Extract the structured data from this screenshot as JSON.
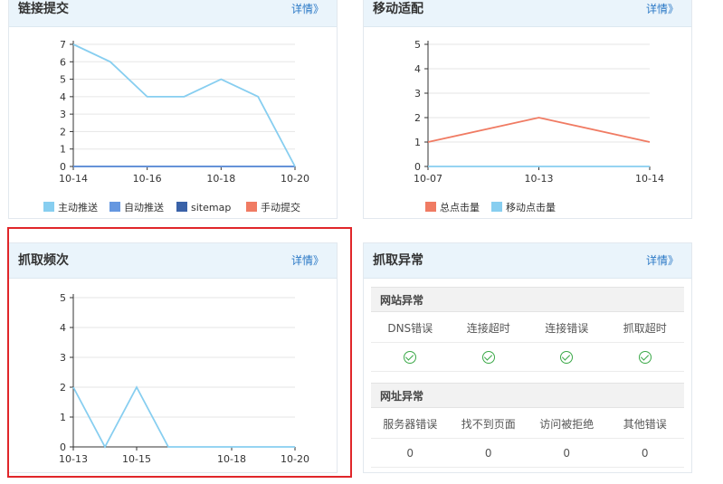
{
  "panels": {
    "link_submit": {
      "title": "链接提交",
      "detail": "详情》"
    },
    "mobile_adapt": {
      "title": "移动适配",
      "detail": "详情》"
    },
    "crawl_freq": {
      "title": "抓取频次",
      "detail": "详情》"
    },
    "crawl_errors": {
      "title": "抓取异常",
      "detail": "详情》"
    }
  },
  "chart_data": [
    {
      "type": "line",
      "x": [
        "10-14",
        "10-15",
        "10-16",
        "10-17",
        "10-18",
        "10-19",
        "10-20"
      ],
      "x_tick_labels": [
        "10-14",
        "10-16",
        "10-18",
        "10-20"
      ],
      "ylim": [
        0,
        7
      ],
      "y_ticks": [
        "0",
        "1",
        "2",
        "3",
        "4",
        "5",
        "6",
        "7"
      ],
      "series": [
        {
          "name": "主动推送",
          "color": "#87cef0",
          "values": [
            7,
            6,
            4,
            4,
            5,
            4,
            0
          ]
        },
        {
          "name": "自动推送",
          "color": "#6597e0",
          "values": [
            0,
            0,
            0,
            0,
            0,
            0,
            0
          ]
        },
        {
          "name": "sitemap",
          "color": "#3a62a8",
          "values": [
            0,
            0,
            0,
            0,
            0,
            0,
            0
          ]
        },
        {
          "name": "手动提交",
          "color": "#f07b63",
          "values": [
            0,
            0,
            0,
            0,
            0,
            0,
            0
          ]
        }
      ],
      "legend": "bottom"
    },
    {
      "type": "line",
      "x": [
        "10-07",
        "10-13",
        "10-14"
      ],
      "x_tick_labels": [
        "10-07",
        "10-13",
        "10-14"
      ],
      "ylim": [
        0,
        5
      ],
      "y_ticks": [
        "0",
        "1",
        "2",
        "3",
        "4",
        "5"
      ],
      "series": [
        {
          "name": "总点击量",
          "color": "#f07b63",
          "values": [
            1,
            2,
            1
          ]
        },
        {
          "name": "移动点击量",
          "color": "#87cef0",
          "values": [
            0,
            0,
            0
          ]
        }
      ],
      "legend": "bottom"
    },
    {
      "type": "line",
      "x": [
        "10-13",
        "10-14",
        "10-15",
        "10-16",
        "10-17",
        "10-18",
        "10-19",
        "10-20"
      ],
      "x_tick_labels": [
        "10-13",
        "10-15",
        "10-18",
        "10-20"
      ],
      "ylim": [
        0,
        5
      ],
      "y_ticks": [
        "0",
        "1",
        "2",
        "3",
        "4",
        "5"
      ],
      "series": [
        {
          "color": "#87cef0",
          "values": [
            2,
            0,
            2,
            0,
            0,
            0,
            0,
            0
          ]
        }
      ]
    }
  ],
  "crawl_errors": {
    "site_title": "网站异常",
    "site_columns": [
      "DNS错误",
      "连接超时",
      "连接错误",
      "抓取超时"
    ],
    "site_status": [
      "ok",
      "ok",
      "ok",
      "ok"
    ],
    "url_title": "网址异常",
    "url_columns": [
      "服务器错误",
      "找不到页面",
      "访问被拒绝",
      "其他错误"
    ],
    "url_values": [
      "0",
      "0",
      "0",
      "0"
    ]
  }
}
